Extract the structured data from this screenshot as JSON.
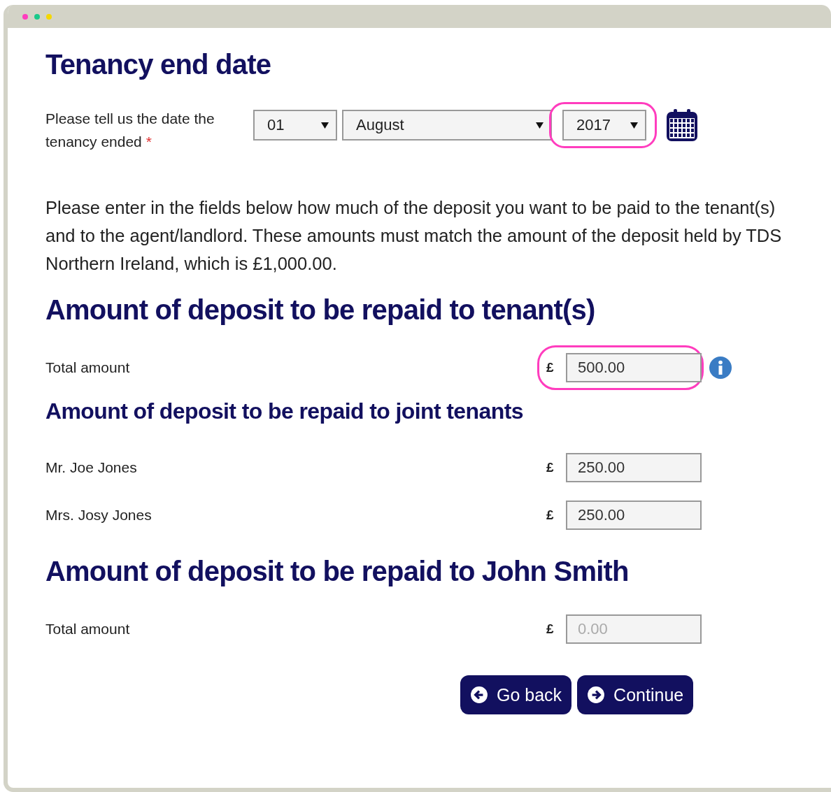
{
  "window": {
    "dots": [
      {
        "color": "#ff3dbe"
      },
      {
        "color": "#19c98a"
      },
      {
        "color": "#f5d800"
      }
    ]
  },
  "date_section": {
    "title": "Tenancy end date",
    "label": "Please tell us the date the tenancy ended",
    "required_mark": "*",
    "selects": [
      {
        "value": "01",
        "kind": "day",
        "highlighted": false
      },
      {
        "value": "August",
        "kind": "month",
        "highlighted": false
      },
      {
        "value": "2017",
        "kind": "year",
        "highlighted": true
      }
    ]
  },
  "intro": "Please enter in the fields below how much of the deposit you want to be paid to the tenant(s) and to the agent/landlord. These amounts must match the amount of the deposit held by TDS Northern Ireland, which is £1,000.00.",
  "sections": [
    {
      "title": "Amount of deposit to be repaid to tenant(s)",
      "kind": "main",
      "rows": [
        {
          "label": "Total amount",
          "currency": "£",
          "value": "500.00",
          "highlighted": true,
          "info": true
        }
      ]
    },
    {
      "title": "Amount of deposit to be repaid to joint tenants",
      "kind": "sub",
      "rows": [
        {
          "label": "Mr. Joe Jones",
          "currency": "£",
          "value": "250.00",
          "highlighted": false,
          "info": false
        },
        {
          "label": "Mrs. Josy Jones",
          "currency": "£",
          "value": "250.00",
          "highlighted": false,
          "info": false
        }
      ]
    },
    {
      "title": "Amount of deposit to be repaid to John Smith",
      "kind": "main",
      "rows": [
        {
          "label": "Total amount",
          "currency": "£",
          "placeholder": "0.00",
          "highlighted": false,
          "info": false
        }
      ]
    }
  ],
  "buttons": [
    {
      "label": "Go back",
      "kind": "back"
    },
    {
      "label": "Continue",
      "kind": "forward"
    }
  ]
}
